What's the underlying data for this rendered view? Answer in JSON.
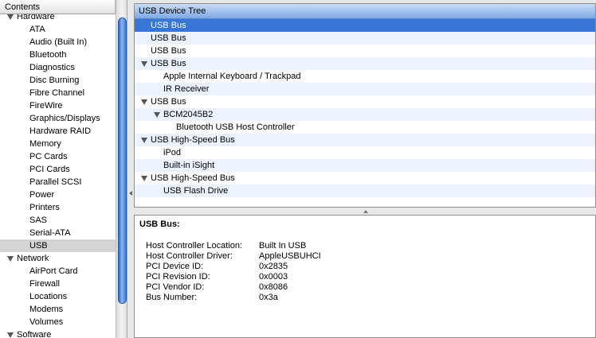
{
  "sidebar": {
    "header": "Contents",
    "rows": [
      {
        "label": "Hardware",
        "type": "cat"
      },
      {
        "label": "ATA",
        "type": "item"
      },
      {
        "label": "Audio (Built In)",
        "type": "item"
      },
      {
        "label": "Bluetooth",
        "type": "item"
      },
      {
        "label": "Diagnostics",
        "type": "item"
      },
      {
        "label": "Disc Burning",
        "type": "item"
      },
      {
        "label": "Fibre Channel",
        "type": "item"
      },
      {
        "label": "FireWire",
        "type": "item"
      },
      {
        "label": "Graphics/Displays",
        "type": "item"
      },
      {
        "label": "Hardware RAID",
        "type": "item"
      },
      {
        "label": "Memory",
        "type": "item"
      },
      {
        "label": "PC Cards",
        "type": "item"
      },
      {
        "label": "PCI Cards",
        "type": "item"
      },
      {
        "label": "Parallel SCSI",
        "type": "item"
      },
      {
        "label": "Power",
        "type": "item"
      },
      {
        "label": "Printers",
        "type": "item"
      },
      {
        "label": "SAS",
        "type": "item"
      },
      {
        "label": "Serial-ATA",
        "type": "item"
      },
      {
        "label": "USB",
        "type": "item",
        "selected": true
      },
      {
        "label": "Network",
        "type": "cat"
      },
      {
        "label": "AirPort Card",
        "type": "item"
      },
      {
        "label": "Firewall",
        "type": "item"
      },
      {
        "label": "Locations",
        "type": "item"
      },
      {
        "label": "Modems",
        "type": "item"
      },
      {
        "label": "Volumes",
        "type": "item"
      },
      {
        "label": "Software",
        "type": "cat"
      }
    ]
  },
  "tree": {
    "header": "USB Device Tree",
    "rows": [
      {
        "label": "USB Bus",
        "level": 0,
        "expanded": false,
        "selected": true
      },
      {
        "label": "USB Bus",
        "level": 0,
        "expanded": false
      },
      {
        "label": "USB Bus",
        "level": 0,
        "expanded": false
      },
      {
        "label": "USB Bus",
        "level": 0,
        "expanded": true
      },
      {
        "label": "Apple Internal Keyboard / Trackpad",
        "level": 1,
        "expanded": false
      },
      {
        "label": "IR Receiver",
        "level": 1,
        "expanded": false
      },
      {
        "label": "USB Bus",
        "level": 0,
        "expanded": true
      },
      {
        "label": "BCM2045B2",
        "level": 1,
        "expanded": true
      },
      {
        "label": "Bluetooth USB Host Controller",
        "level": 2,
        "expanded": false
      },
      {
        "label": "USB High-Speed Bus",
        "level": 0,
        "expanded": true
      },
      {
        "label": "iPod",
        "level": 1,
        "expanded": false
      },
      {
        "label": "Built-in iSight",
        "level": 1,
        "expanded": false
      },
      {
        "label": "USB High-Speed Bus",
        "level": 0,
        "expanded": true
      },
      {
        "label": "USB Flash Drive",
        "level": 1,
        "expanded": false
      }
    ]
  },
  "detail": {
    "title": "USB Bus:",
    "fields": [
      {
        "key": "Host Controller Location:",
        "value": "Built In USB"
      },
      {
        "key": "Host Controller Driver:",
        "value": "AppleUSBUHCI"
      },
      {
        "key": "PCI Device ID:",
        "value": "0x2835"
      },
      {
        "key": "PCI Revision ID:",
        "value": "0x0003"
      },
      {
        "key": "PCI Vendor ID:",
        "value": "0x8086"
      },
      {
        "key": "Bus Number:",
        "value": "0x3a"
      }
    ]
  },
  "colors": {
    "selection": "#3875d7",
    "sidebar_selection": "#d4d4d4",
    "header_blue": "#7ea8e4"
  }
}
